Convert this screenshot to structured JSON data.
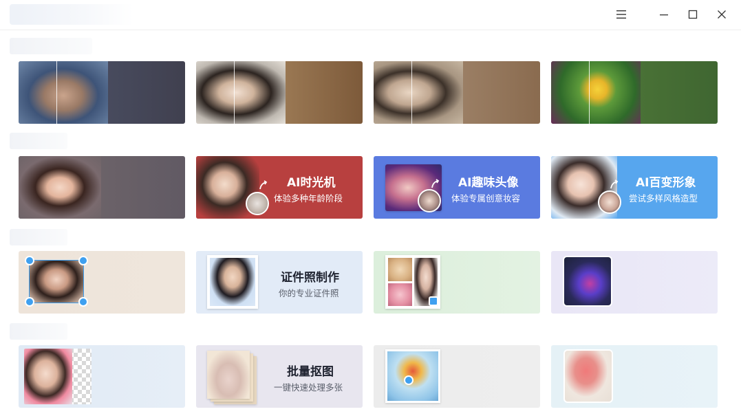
{
  "window": {
    "controls": [
      {
        "name": "menu-icon"
      },
      {
        "name": "minimize-icon"
      },
      {
        "name": "maximize-icon"
      },
      {
        "name": "close-icon"
      }
    ]
  },
  "cards": {
    "time_machine": {
      "title": "AI时光机",
      "subtitle": "体验多种年龄阶段"
    },
    "fun_avatar": {
      "title": "AI趣味头像",
      "subtitle": "体验专属创意妆容"
    },
    "style_change": {
      "title": "AI百变形象",
      "subtitle": "尝试多样风格造型"
    },
    "id_photo": {
      "title": "证件照制作",
      "subtitle": "你的专业证件照"
    },
    "batch_cutout": {
      "title": "批量抠图",
      "subtitle": "一键快速处理多张"
    }
  },
  "colors": {
    "time_machine_bg": "#b8403f",
    "fun_avatar_bg": "#5a7be0",
    "style_change_bg": "#57a6ee"
  }
}
